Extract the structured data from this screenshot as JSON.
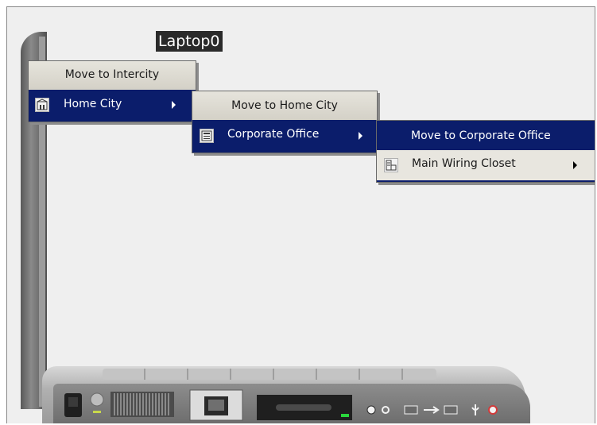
{
  "device": {
    "title": "Laptop0"
  },
  "menus": {
    "level1": {
      "header": "Move to Intercity",
      "items": [
        {
          "label": "Home City",
          "icon": "building-icon",
          "has_submenu": true,
          "selected": true
        }
      ]
    },
    "level2": {
      "header": "Move to Home City",
      "items": [
        {
          "label": "Corporate Office",
          "icon": "office-icon",
          "has_submenu": true,
          "selected": true
        }
      ]
    },
    "level3": {
      "header": "Move to Corporate Office",
      "items": [
        {
          "label": "Main Wiring Closet",
          "icon": "wiring-closet-icon",
          "has_submenu": true,
          "selected": false
        }
      ]
    }
  },
  "colors": {
    "menu_highlight": "#0b1d6b",
    "menu_background": "#e8e6df",
    "device_title_background": "#2a2a2a",
    "workspace_background": "#efefef"
  }
}
